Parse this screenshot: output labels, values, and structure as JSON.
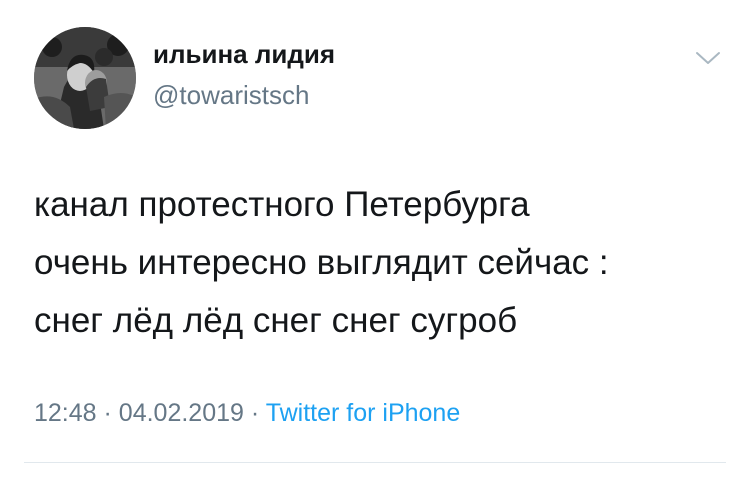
{
  "tweet": {
    "author": {
      "display_name": "ильина лидия",
      "handle": "@towaristsch",
      "avatar_icon": "avatar-photo"
    },
    "menu_icon": "chevron-down-icon",
    "text_lines": [
      "канал протестного Петербурга",
      "очень интересно выглядит сейчас :",
      "снег лёд лёд снег снег сугроб"
    ],
    "time": "12:48",
    "date": "04.02.2019",
    "separator": "·",
    "source": "Twitter for iPhone",
    "colors": {
      "text": "#14171a",
      "secondary": "#657786",
      "link": "#1da1f2",
      "divider": "#e1e8ed"
    }
  }
}
